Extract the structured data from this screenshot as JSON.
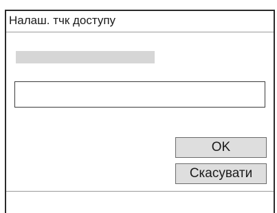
{
  "dialog": {
    "title": "Налаш. тчк доступу",
    "field": {
      "value": "",
      "placeholder": ""
    },
    "buttons": {
      "ok_label": "OK",
      "cancel_label": "Скасувати"
    }
  },
  "colors": {
    "border": "#2a2a2a",
    "button_bg": "#dedede",
    "label_bar": "#d6d6d6"
  }
}
